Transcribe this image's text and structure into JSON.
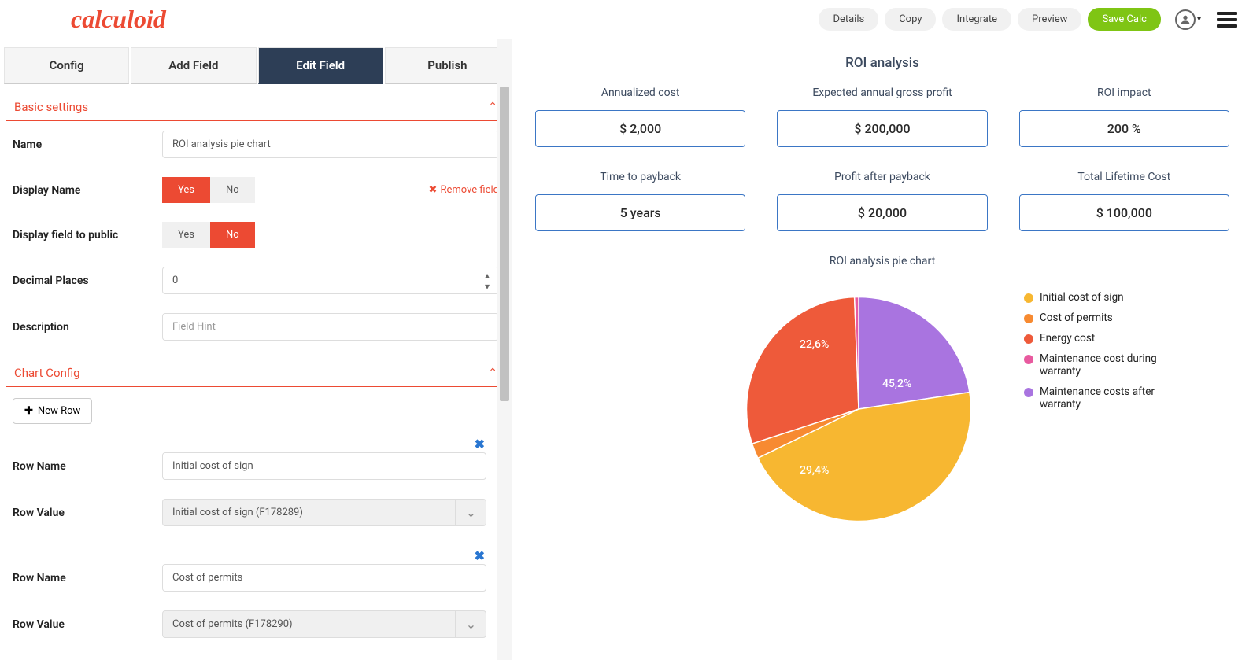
{
  "brand": "calculoid",
  "header": {
    "details": "Details",
    "copy": "Copy",
    "integrate": "Integrate",
    "preview": "Preview",
    "save": "Save Calc"
  },
  "tabs": {
    "config": "Config",
    "add_field": "Add Field",
    "edit_field": "Edit Field",
    "publish": "Publish"
  },
  "basic": {
    "section": "Basic settings",
    "name_label": "Name",
    "name_value": "ROI analysis pie chart",
    "display_name_label": "Display Name",
    "yes": "Yes",
    "no": "No",
    "remove_field": "Remove field",
    "display_public_label": "Display field to public",
    "decimal_label": "Decimal Places",
    "decimal_value": "0",
    "description_label": "Description",
    "description_placeholder": "Field Hint"
  },
  "chart_config": {
    "section": "Chart Config",
    "new_row": "New Row",
    "row_name_label": "Row Name",
    "row_value_label": "Row Value",
    "rows": [
      {
        "name": "Initial cost of sign",
        "value": "Initial cost of sign (F178289)"
      },
      {
        "name": "Cost of permits",
        "value": "Cost of permits (F178290)"
      }
    ]
  },
  "preview": {
    "title": "ROI analysis",
    "cards1": [
      {
        "label": "Annualized cost",
        "value": "$ 2,000"
      },
      {
        "label": "Expected annual gross profit",
        "value": "$ 200,000"
      },
      {
        "label": "ROI impact",
        "value": "200 %"
      }
    ],
    "cards2": [
      {
        "label": "Time to payback",
        "value": "5 years"
      },
      {
        "label": "Profit after payback",
        "value": "$ 20,000"
      },
      {
        "label": "Total Lifetime Cost",
        "value": "$ 100,000"
      }
    ],
    "chart_title": "ROI analysis pie chart"
  },
  "chart_data": {
    "type": "pie",
    "title": "ROI analysis pie chart",
    "series": [
      {
        "name": "Initial cost of sign",
        "value": 45.2,
        "color": "#f7b731",
        "label": "45,2%"
      },
      {
        "name": "Cost of permits",
        "value": 2.2,
        "color": "#f78a31",
        "label": ""
      },
      {
        "name": "Energy cost",
        "value": 29.4,
        "color": "#ee5a3a",
        "label": "29,4%"
      },
      {
        "name": "Maintenance cost during warranty",
        "value": 0.6,
        "color": "#e85a9f",
        "label": ""
      },
      {
        "name": "Maintenance costs after warranty",
        "value": 22.6,
        "color": "#a974e0",
        "label": "22,6%"
      }
    ]
  }
}
